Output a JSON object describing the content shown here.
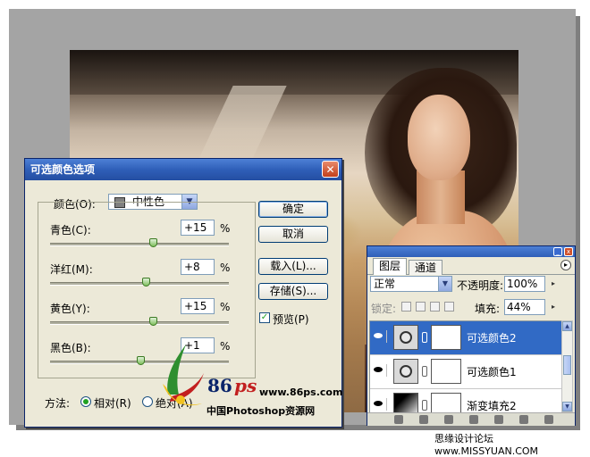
{
  "dialog": {
    "title": "可选颜色选项",
    "close_glyph": "✕",
    "colors_label": "颜色(O):",
    "colors_selected": "中性色",
    "sliders": [
      {
        "label": "青色(C):",
        "value": "+15",
        "unit": "%",
        "level": 0.58
      },
      {
        "label": "洋红(M):",
        "value": "+8",
        "unit": "%",
        "level": 0.54
      },
      {
        "label": "黄色(Y):",
        "value": "+15",
        "unit": "%",
        "level": 0.58
      },
      {
        "label": "黑色(B):",
        "value": "+1",
        "unit": "%",
        "level": 0.505
      }
    ],
    "buttons": {
      "ok": "确定",
      "cancel": "取消",
      "load": "载入(L)...",
      "save": "存储(S)..."
    },
    "preview_label": "预览(P)",
    "preview_checked": true,
    "method_label": "方法:",
    "method_relative": "相对(R)",
    "method_absolute": "绝对(A)",
    "method_selected": "relative"
  },
  "layers_panel": {
    "tabs": [
      "图层",
      "通道"
    ],
    "active_tab": "图层",
    "blend_mode": "正常",
    "opacity_label": "不透明度:",
    "opacity": "100%",
    "lock_label": "锁定:",
    "fill_label": "填充:",
    "fill": "44%",
    "layers": [
      {
        "name": "可选颜色2",
        "selected": true
      },
      {
        "name": "可选颜色1",
        "selected": false
      },
      {
        "name": "渐变填充2",
        "selected": false
      }
    ]
  },
  "watermark": {
    "num": "86",
    "ps": "ps",
    "url": "www.86ps.com",
    "cn": "中国Photoshop资源网",
    "forum": "思缘设计论坛 www.MISSYUAN.COM"
  },
  "colors": {
    "accent": "#316ac5",
    "title_bar": "#2f5fb8",
    "stage": "#a4a4a4"
  }
}
